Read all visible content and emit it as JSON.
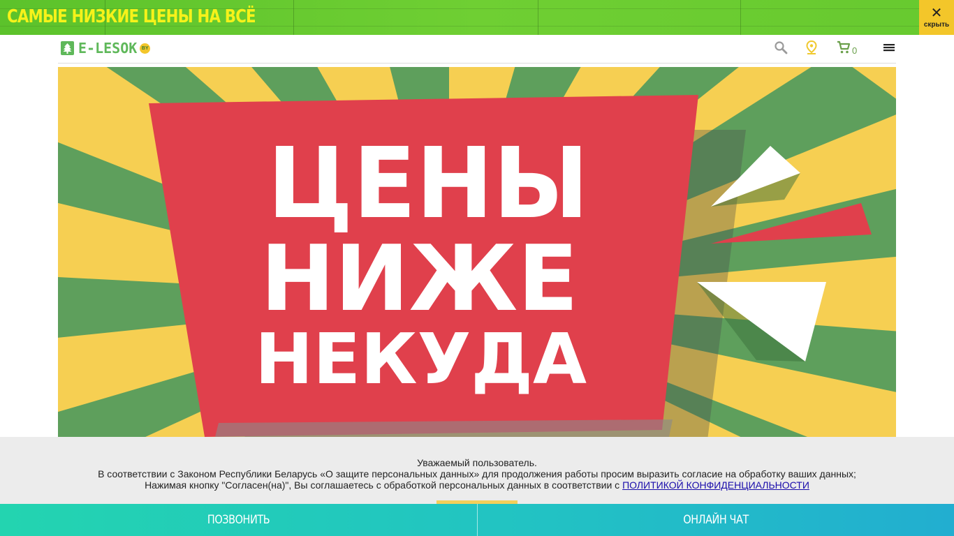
{
  "promo": {
    "text": "САМЫЕ НИЗКИЕ ЦЕНЫ НА ВСЁ",
    "close_glyph": "✕",
    "close_label": "скрыть",
    "close_icon": "close-icon"
  },
  "header": {
    "logo_text": "E-LESOK",
    "logo_badge": "BY",
    "icons": [
      "search-icon",
      "location-pin-icon",
      "cart-icon",
      "menu-icon"
    ],
    "cart_count": "0"
  },
  "hero": {
    "line1": "ЦЕНЫ",
    "line2": "НИЖЕ",
    "line3": "НЕКУДА",
    "colors": {
      "red": "#e0404c",
      "green": "#5e9f5c",
      "yellow": "#f6cf52",
      "white": "#ffffff"
    }
  },
  "cookie": {
    "line1": "Уважаемый пользователь.",
    "line2": "В соответствии с Законом Республики Беларусь «О защите персональных данных» для продолжения работы просим выразить согласие на обработку ваших данных;",
    "line3": "Нажимая кнопку \"Согласен(на)\", Вы соглашаетесь с обработкой персональных данных в соответствии с ",
    "policy_link": "ПОЛИТИКОЙ КОНФИДЕНЦИАЛЬНОСТИ"
  },
  "bottom": {
    "call_label": "ПОЗВОНИТЬ",
    "chat_label": "ОНЛАЙН ЧАТ"
  }
}
